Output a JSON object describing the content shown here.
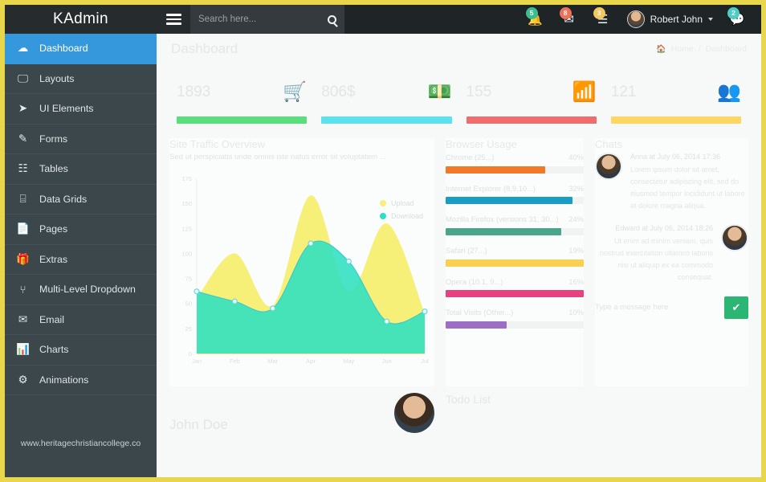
{
  "brand": {
    "name": "KAdmin"
  },
  "search": {
    "placeholder": "Search here...",
    "value": ""
  },
  "header": {
    "icons": [
      {
        "name": "bell-icon",
        "glyph": "🔔",
        "badge": "5",
        "badge_color": "#3dbd8e"
      },
      {
        "name": "envelope-icon",
        "glyph": "✉",
        "badge": "8",
        "badge_color": "#f0715a"
      },
      {
        "name": "tasks-icon",
        "glyph": "☰",
        "badge": "3",
        "badge_color": "#f5c761"
      },
      {
        "name": "comments-icon",
        "glyph": "💬",
        "badge": "2",
        "badge_color": "#4ecdc4"
      }
    ],
    "user": {
      "name": "Robert John"
    }
  },
  "sidebar": {
    "items": [
      {
        "label": "Dashboard",
        "icon": "☁",
        "active": true
      },
      {
        "label": "Layouts",
        "icon": "🖵",
        "active": false
      },
      {
        "label": "UI Elements",
        "icon": "➤",
        "active": false
      },
      {
        "label": "Forms",
        "icon": "✎",
        "active": false
      },
      {
        "label": "Tables",
        "icon": "☷",
        "active": false
      },
      {
        "label": "Data Grids",
        "icon": "⌸",
        "active": false
      },
      {
        "label": "Pages",
        "icon": "📄",
        "active": false
      },
      {
        "label": "Extras",
        "icon": "🎁",
        "active": false
      },
      {
        "label": "Multi-Level Dropdown",
        "icon": "⑂",
        "active": false
      },
      {
        "label": "Email",
        "icon": "✉",
        "active": false
      },
      {
        "label": "Charts",
        "icon": "📊",
        "active": false
      },
      {
        "label": "Animations",
        "icon": "⚙",
        "active": false
      }
    ],
    "watermark": "www.heritagechristiancollege.co"
  },
  "page": {
    "title": "Dashboard",
    "breadcrumb_home": "Home",
    "breadcrumb_current": "Dashboard"
  },
  "stats": [
    {
      "name": "orders",
      "value": "1893",
      "icon": "🛒",
      "bar_color": "#5ade7b",
      "bar_pct": 100
    },
    {
      "name": "revenue",
      "value": "806$",
      "icon": "💵",
      "bar_color": "#5ce1ef",
      "bar_pct": 100
    },
    {
      "name": "visits",
      "value": "155",
      "icon": "📶",
      "bar_color": "#ef6d6d",
      "bar_pct": 100
    },
    {
      "name": "users",
      "value": "121",
      "icon": "👥",
      "bar_color": "#ffd662",
      "bar_pct": 100
    }
  ],
  "chart_panel": {
    "title": "Site Traffic Overview",
    "subtitle": "Sed ut perspiciatis unde omnis iste natus error sit voluptatem ..."
  },
  "chart_data": {
    "type": "area",
    "title": "Site Traffic Overview",
    "xlabel": "",
    "ylabel": "",
    "categories": [
      "Jan",
      "Feb",
      "Mar",
      "Apr",
      "May",
      "Jun",
      "Jul"
    ],
    "ylim": [
      0,
      175
    ],
    "yticks": [
      0,
      25,
      50,
      75,
      100,
      125,
      150,
      175
    ],
    "grid": false,
    "legend_position": "top-right",
    "series": [
      {
        "name": "Upload",
        "color": "#f7f078",
        "values": [
          55,
          100,
          48,
          158,
          62,
          130,
          40
        ]
      },
      {
        "name": "Download",
        "color": "#2fe0c0",
        "values": [
          62,
          52,
          45,
          110,
          92,
          32,
          42
        ]
      }
    ]
  },
  "browser_panel": {
    "title": "Browser Usage",
    "rows": [
      {
        "label": "Chrome (25...)",
        "value": "40%",
        "pct": 72,
        "color": "#f3792a"
      },
      {
        "label": "Internet Explorer (8,9,10...)",
        "value": "32%",
        "pct": 92,
        "color": "#1a9dc4"
      },
      {
        "label": "Mozilla Firefox (versions 31, 30...)",
        "value": "24%",
        "pct": 84,
        "color": "#4aa58a"
      },
      {
        "label": "Safari (27...)",
        "value": "19%",
        "pct": 100,
        "color": "#fbcf4f"
      },
      {
        "label": "Opera (10.1, 9...)",
        "value": "16%",
        "pct": 100,
        "color": "#e8417f"
      },
      {
        "label": "Total Visits (Other...)",
        "value": "10%",
        "pct": 44,
        "color": "#9b6fc6"
      }
    ]
  },
  "chats": {
    "title": "Chats",
    "messages": [
      {
        "side": "left",
        "meta": "Anna  at July 06, 2014 17:36",
        "text": "Lorem ipsum dolor sit amet, consectetur adipiscing elit, sed do eiusmod tempor incididunt ut labore et dolore magna aliqua."
      },
      {
        "side": "right",
        "meta": "Edward  at July 06, 2014 18:26",
        "text": "Ut enim ad minim veniam, quis nostrud exercitation ullamco laboris nisi ut aliquip ex ea commodo consequat."
      }
    ],
    "input_placeholder": "Type a message here",
    "send_label": "✔"
  },
  "bottom": {
    "profile_name": "John Doe",
    "todo_title": "Todo List"
  }
}
